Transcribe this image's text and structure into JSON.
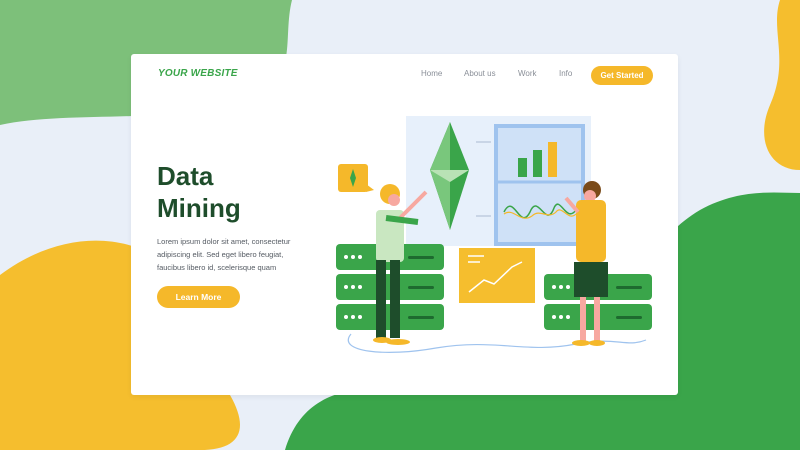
{
  "brand": "YOUR WEBSITE",
  "nav": {
    "items": [
      "Home",
      "About us",
      "Work",
      "Info"
    ],
    "cta": "Get Started"
  },
  "hero": {
    "title_line1": "Data",
    "title_line2": "Mining",
    "description": "Lorem ipsum dolor sit amet, consectetur adipiscing elit. Sed eget libero feugiat, faucibus libero id, scelerisque quam",
    "button": "Learn More"
  },
  "colors": {
    "green": "#3aa54a",
    "yellow": "#f5b82a",
    "dark_green": "#1e4d2b",
    "light_bg": "#e9eff8"
  }
}
